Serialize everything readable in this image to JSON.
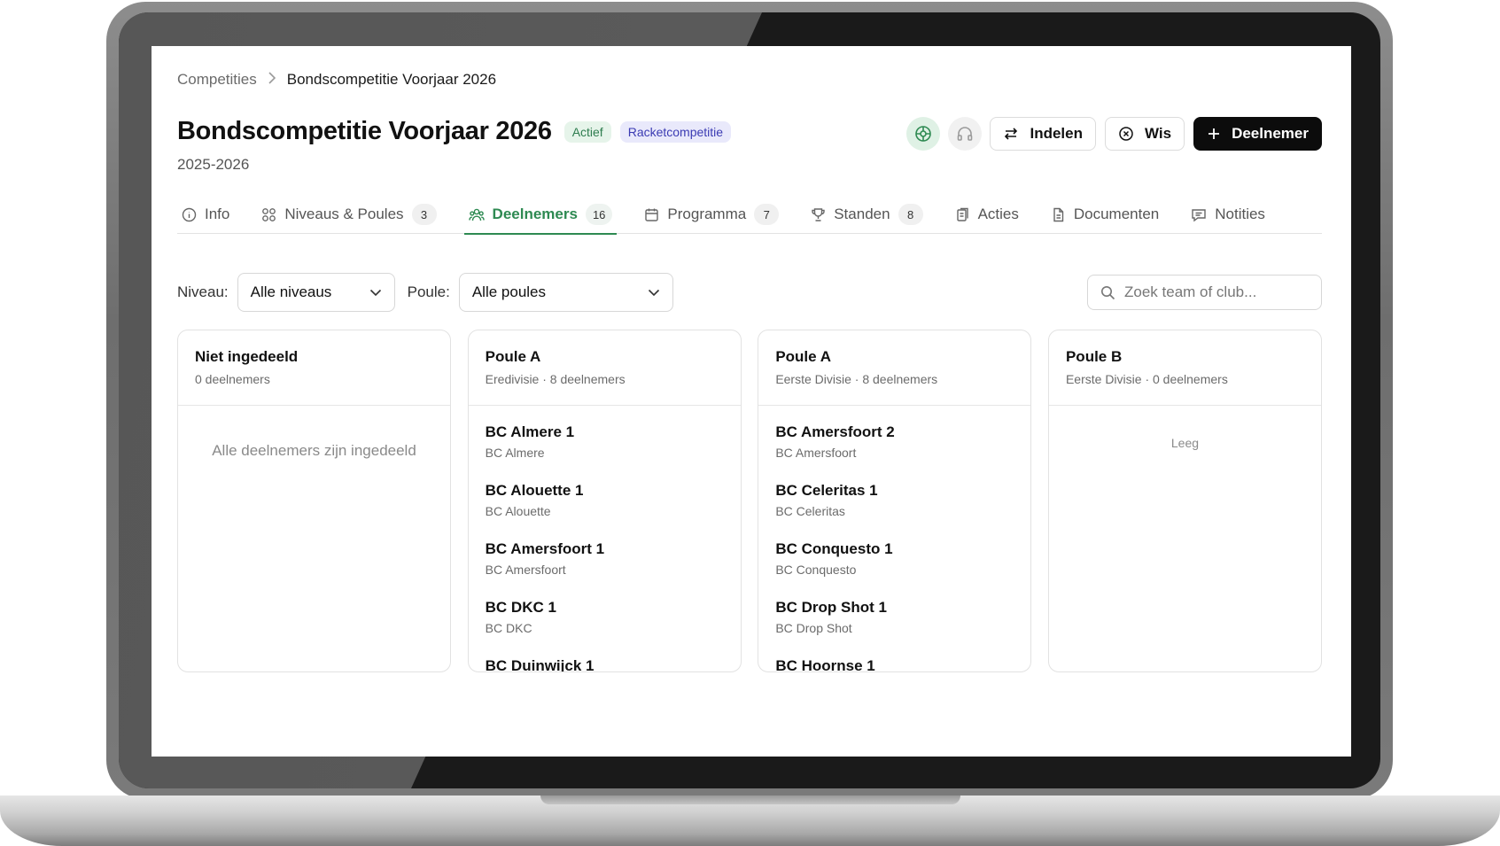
{
  "breadcrumb": {
    "parent": "Competities",
    "current": "Bondscompetitie Voorjaar 2026"
  },
  "header": {
    "title": "Bondscompetitie Voorjaar 2026",
    "status_badge": "Actief",
    "type_badge": "Racketcompetitie",
    "season": "2025-2026"
  },
  "actions": {
    "indelen_label": "Indelen",
    "wis_label": "Wis",
    "deelnemer_label": "Deelnemer"
  },
  "tabs": [
    {
      "label": "Info",
      "count": ""
    },
    {
      "label": "Niveaus & Poules",
      "count": "3"
    },
    {
      "label": "Deelnemers",
      "count": "16"
    },
    {
      "label": "Programma",
      "count": "7"
    },
    {
      "label": "Standen",
      "count": "8"
    },
    {
      "label": "Acties",
      "count": ""
    },
    {
      "label": "Documenten",
      "count": ""
    },
    {
      "label": "Notities",
      "count": ""
    }
  ],
  "filters": {
    "niveau_label": "Niveau:",
    "niveau_value": "Alle niveaus",
    "poule_label": "Poule:",
    "poule_value": "Alle poules",
    "search_placeholder": "Zoek team of club..."
  },
  "columns": [
    {
      "title": "Niet ingedeeld",
      "subtitle": "0 deelnemers",
      "empty_text": "Alle deelnemers zijn ingedeeld",
      "teams": []
    },
    {
      "title": "Poule A",
      "subtitle": "Eredivisie · 8 deelnemers",
      "teams": [
        {
          "name": "BC Almere 1",
          "club": "BC Almere"
        },
        {
          "name": "BC Alouette 1",
          "club": "BC Alouette"
        },
        {
          "name": "BC Amersfoort 1",
          "club": "BC Amersfoort"
        },
        {
          "name": "BC DKC 1",
          "club": "BC DKC"
        },
        {
          "name": "BC Duinwijck 1",
          "club": ""
        }
      ]
    },
    {
      "title": "Poule A",
      "subtitle": "Eerste Divisie · 8 deelnemers",
      "teams": [
        {
          "name": "BC Amersfoort 2",
          "club": "BC Amersfoort"
        },
        {
          "name": "BC Celeritas 1",
          "club": "BC Celeritas"
        },
        {
          "name": "BC Conquesto 1",
          "club": "BC Conquesto"
        },
        {
          "name": "BC Drop Shot 1",
          "club": "BC Drop Shot"
        },
        {
          "name": "BC Hoornse 1",
          "club": ""
        }
      ]
    },
    {
      "title": "Poule B",
      "subtitle": "Eerste Divisie · 0 deelnemers",
      "empty_text": "Leeg",
      "teams": []
    }
  ],
  "colors": {
    "accent_green": "#2e8a52",
    "primary_button": "#0c0c0c",
    "badge_type": "#3b3bb3"
  }
}
